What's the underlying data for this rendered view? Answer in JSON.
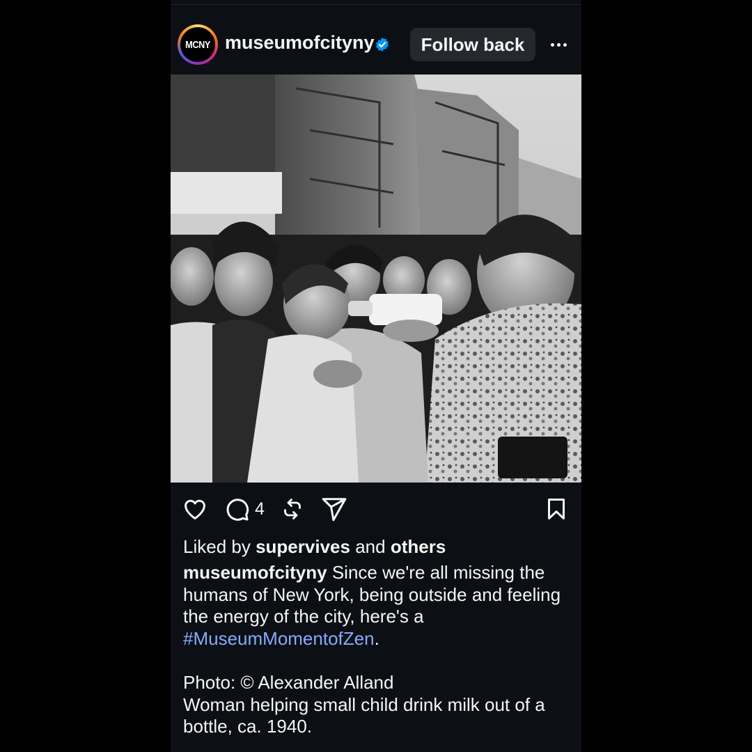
{
  "post": {
    "account": {
      "avatar_text": "MCNY",
      "username": "museumofcityny",
      "verified": true,
      "follow_label": "Follow back"
    },
    "image": {
      "alt": "Black and white photo of a crowd in a city street; a woman holds a milk bottle for a small child"
    },
    "actions": {
      "comment_count": "4"
    },
    "likes": {
      "prefix": "Liked by",
      "user": "supervives",
      "and": "and",
      "others": "others"
    },
    "caption": {
      "username": "museumofcityny",
      "text": "Since we're all missing the humans of New York, being outside and feeling the energy of the city, here's a",
      "hashtag": "#MuseumMomentofZen",
      "period": ".",
      "credit": "Photo: © Alexander Alland",
      "description": "Woman helping small child drink milk out of a bottle, ca. 1940."
    },
    "colors": {
      "background": "#0c1014",
      "button": "#25292e",
      "hashtag": "#8aa8ff",
      "verified": "#0095f6"
    }
  }
}
